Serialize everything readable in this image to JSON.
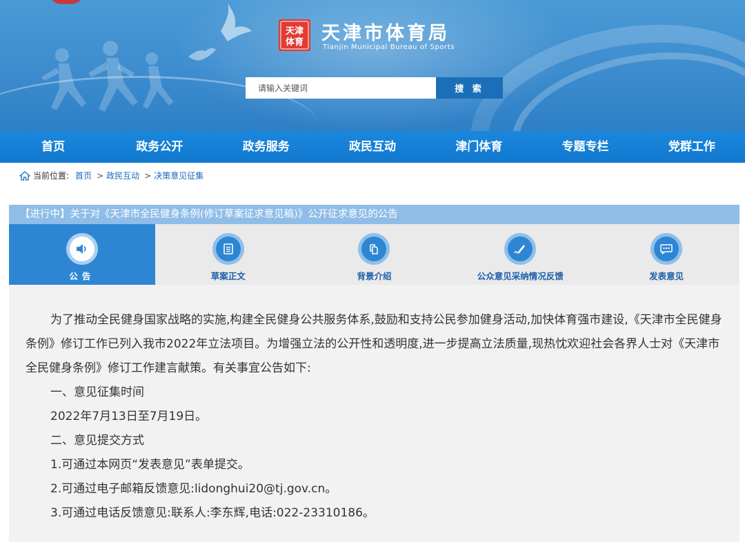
{
  "header": {
    "title_cn": "天津市体育局",
    "title_en": "Tianjin Municipal Bureau of Sports",
    "logo_text": "天津体育"
  },
  "search": {
    "placeholder": "请输入关键词",
    "button_label": "搜 索"
  },
  "nav": {
    "items": [
      "首页",
      "政务公开",
      "政务服务",
      "政民互动",
      "津门体育",
      "专题专栏",
      "党群工作"
    ]
  },
  "breadcrumb": {
    "prefix": "当前位置:",
    "items": [
      "首页",
      "政民互动",
      "决策意见征集"
    ],
    "separator": ">"
  },
  "notice": {
    "title": "【进行中】关于对《天津市全民健身条例(修订草案征求意见稿)》公开征求意见的公告"
  },
  "tabs": [
    {
      "label": "公告",
      "icon": "speaker-icon",
      "active": true
    },
    {
      "label": "草案正文",
      "icon": "document-icon",
      "active": false
    },
    {
      "label": "背景介绍",
      "icon": "copy-icon",
      "active": false
    },
    {
      "label": "公众意见采纳情况反馈",
      "icon": "pen-icon",
      "active": false
    },
    {
      "label": "发表意见",
      "icon": "chat-icon",
      "active": false
    }
  ],
  "content": {
    "intro": "为了推动全民健身国家战略的实施,构建全民健身公共服务体系,鼓励和支持公民参加健身活动,加快体育强市建设,《天津市全民健身条例》修订工作已列入我市2022年立法项目。为增强立法的公开性和透明度,进一步提高立法质量,现热忱欢迎社会各界人士对《天津市全民健身条例》修订工作建言献策。有关事宜公告如下:",
    "section1_title": "一、意见征集时间",
    "section1_body": "2022年7月13日至7月19日。",
    "section2_title": "二、意见提交方式",
    "method1": "1.可通过本网页“发表意见”表单提交。",
    "method2": "2.可通过电子邮箱反馈意见:lidonghui20@tj.gov.cn。",
    "method3": "3.可通过电话反馈意见:联系人:李东辉,电话:022-23310186。"
  },
  "colors": {
    "banner": "#3f8fd0",
    "nav": "#1179cf",
    "active_tab": "#2e86d3",
    "title_bar": "#8fbde8",
    "link": "#1a6ab8"
  }
}
